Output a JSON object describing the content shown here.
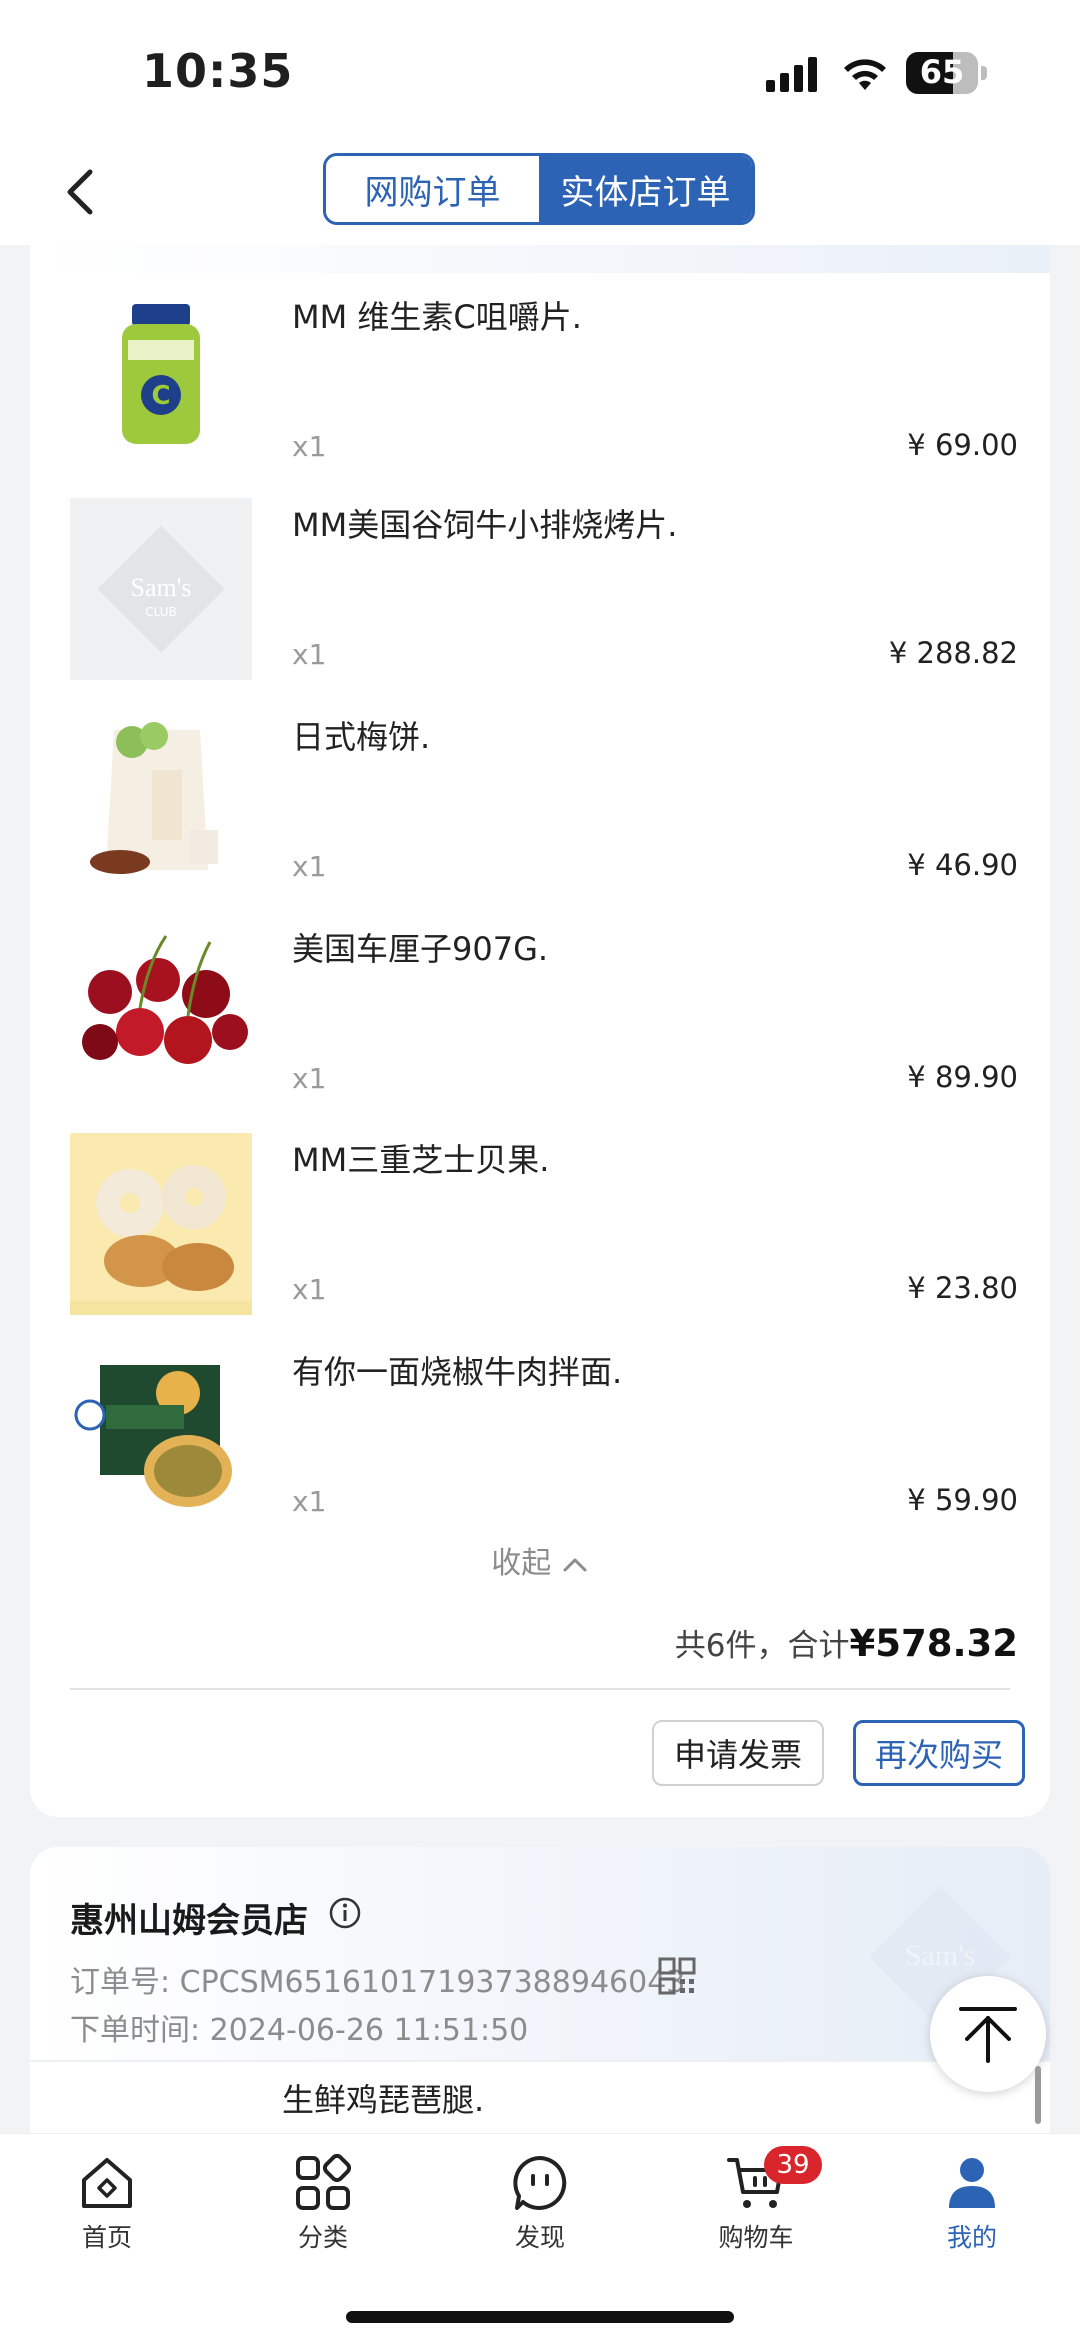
{
  "status_bar": {
    "time": "10:35",
    "battery": "65",
    "battery_level": 0.65
  },
  "header": {
    "tabs": [
      {
        "label": "网购订单",
        "active": false
      },
      {
        "label": "实体店订单",
        "active": true
      }
    ]
  },
  "order1": {
    "items": [
      {
        "name": "MM 维生素C咀嚼片.",
        "qty": "x1",
        "price": "¥ 69.00",
        "image": "vitamin-c-bottle"
      },
      {
        "name": "MM美国谷饲牛小排烧烤片.",
        "qty": "x1",
        "price": "¥ 288.82",
        "image": "sams-club-placeholder"
      },
      {
        "name": "日式梅饼.",
        "qty": "x1",
        "price": "¥ 46.90",
        "image": "plum-cake-bag"
      },
      {
        "name": "美国车厘子907G.",
        "qty": "x1",
        "price": "¥ 89.90",
        "image": "cherries"
      },
      {
        "name": "MM三重芝士贝果.",
        "qty": "x1",
        "price": "¥ 23.80",
        "image": "cheese-bagel"
      },
      {
        "name": "有你一面烧椒牛肉拌面.",
        "qty": "x1",
        "price": "¥ 59.90",
        "image": "beef-noodle-box"
      }
    ],
    "collapse_label": "收起",
    "summary_prefix": "共6件，合计",
    "total": "¥578.32",
    "invoice_label": "申请发票",
    "rebuy_label": "再次购买"
  },
  "order2": {
    "store": "惠州山姆会员店",
    "order_no": "订单号: CPCSM6516101719373889460​43",
    "order_time": "下单时间: 2024-06-26 11:51:50",
    "first_item": "生鲜鸡琵琶腿."
  },
  "tabbar": {
    "items": [
      {
        "label": "首页",
        "icon": "home-icon"
      },
      {
        "label": "分类",
        "icon": "category-icon"
      },
      {
        "label": "发现",
        "icon": "discover-icon"
      },
      {
        "label": "购物车",
        "icon": "cart-icon",
        "badge": "39"
      },
      {
        "label": "我的",
        "icon": "profile-icon",
        "active": true
      }
    ]
  },
  "colors": {
    "accent": "#2d63b4",
    "badge": "#d9262c"
  }
}
